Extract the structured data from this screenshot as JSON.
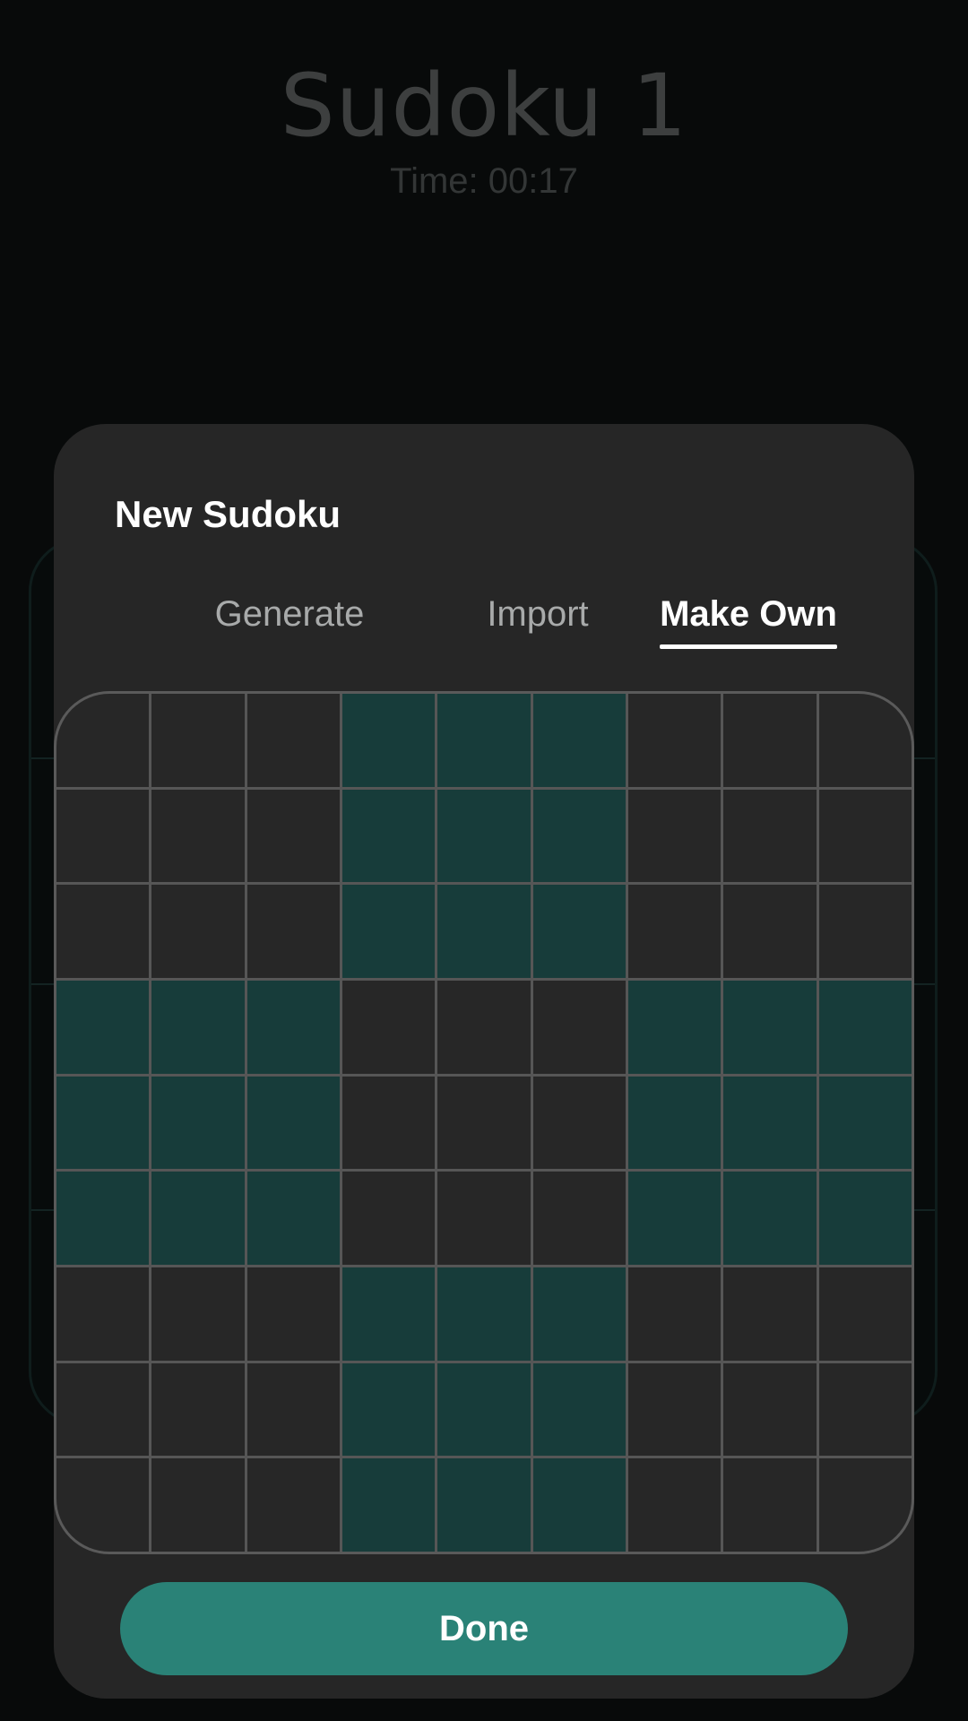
{
  "background": {
    "title": "Sudoku 1",
    "timer": "Time: 00:17"
  },
  "dialog": {
    "title": "New Sudoku",
    "tabs": [
      {
        "label": "Generate",
        "active": false
      },
      {
        "label": "Import",
        "active": false
      },
      {
        "label": "Make Own",
        "active": true
      }
    ],
    "grid": {
      "rows": 9,
      "cols": 9,
      "cells": [
        [
          "",
          "",
          "",
          "",
          "",
          "",
          "",
          "",
          ""
        ],
        [
          "",
          "",
          "",
          "",
          "",
          "",
          "",
          "",
          ""
        ],
        [
          "",
          "",
          "",
          "",
          "",
          "",
          "",
          "",
          ""
        ],
        [
          "",
          "",
          "",
          "",
          "",
          "",
          "",
          "",
          ""
        ],
        [
          "",
          "",
          "",
          "",
          "",
          "",
          "",
          "",
          ""
        ],
        [
          "",
          "",
          "",
          "",
          "",
          "",
          "",
          "",
          ""
        ],
        [
          "",
          "",
          "",
          "",
          "",
          "",
          "",
          "",
          ""
        ],
        [
          "",
          "",
          "",
          "",
          "",
          "",
          "",
          "",
          ""
        ],
        [
          "",
          "",
          "",
          "",
          "",
          "",
          "",
          "",
          ""
        ]
      ]
    },
    "done_label": "Done"
  },
  "colors": {
    "background": "#080a0a",
    "dialog": "#262626",
    "cell": "#272727",
    "cell_shaded": "#173c3a",
    "grid_line": "#565656",
    "accent": "#2a8277"
  }
}
